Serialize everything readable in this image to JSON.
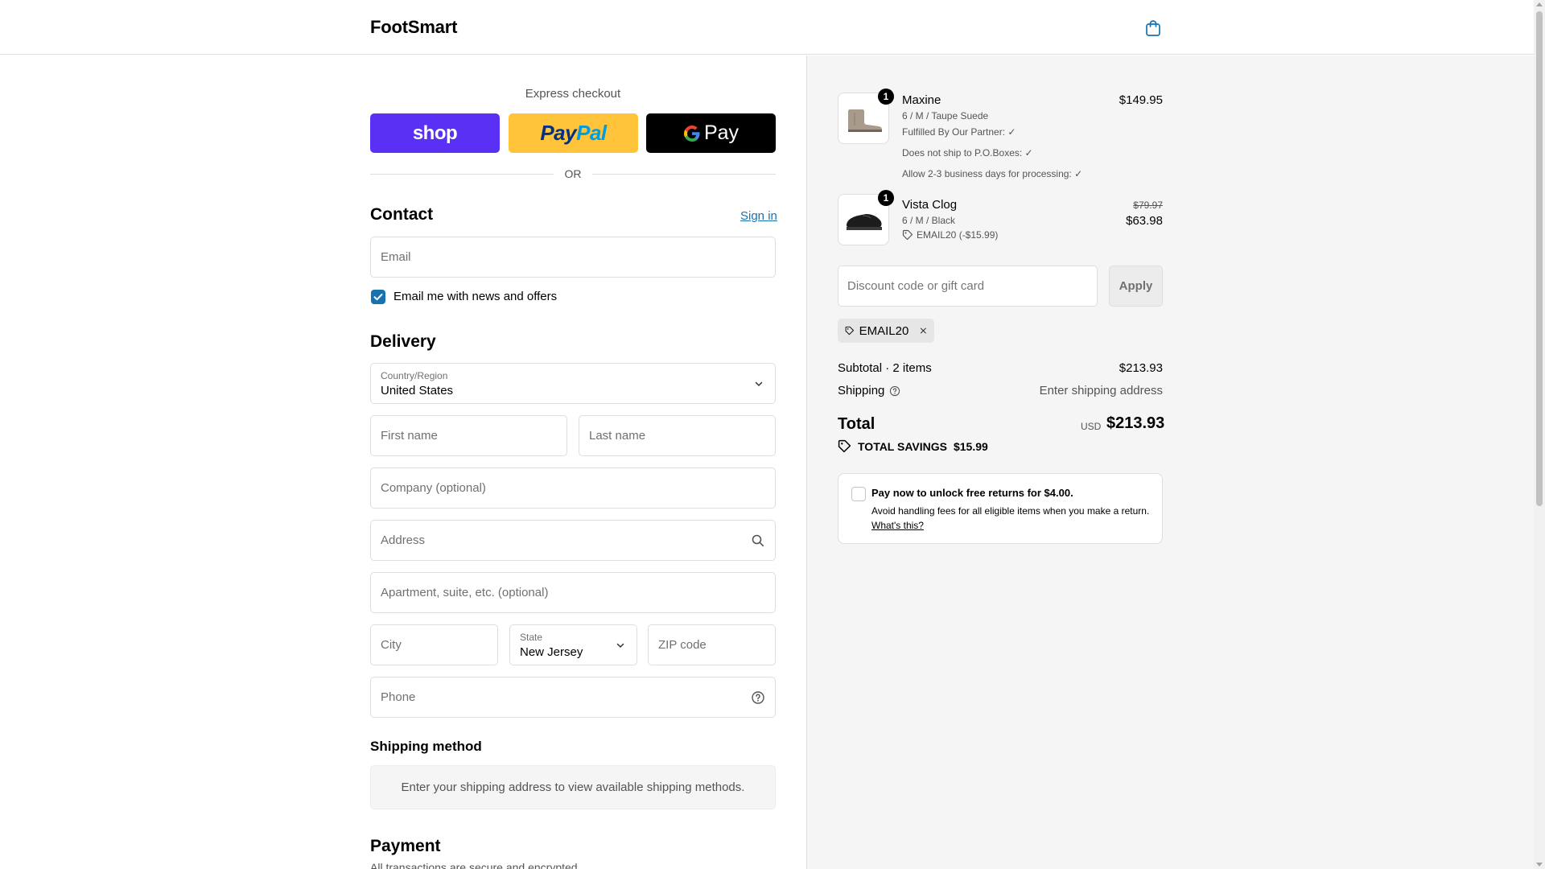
{
  "header": {
    "brand": "FootSmart",
    "cart_icon": "bag-icon"
  },
  "express": {
    "title": "Express checkout",
    "shop_label": "shop",
    "paypal_part1": "Pay",
    "paypal_part2": "Pal",
    "gpay_label": "Pay",
    "or_label": "OR"
  },
  "contact": {
    "heading": "Contact",
    "sign_in": "Sign in",
    "email_placeholder": "Email",
    "newsletter_label": "Email me with news and offers",
    "newsletter_checked": true
  },
  "delivery": {
    "heading": "Delivery",
    "country_label": "Country/Region",
    "country_value": "United States",
    "first_name_placeholder": "First name",
    "last_name_placeholder": "Last name",
    "company_placeholder": "Company (optional)",
    "address_placeholder": "Address",
    "apartment_placeholder": "Apartment, suite, etc. (optional)",
    "city_placeholder": "City",
    "state_label": "State",
    "state_value": "New Jersey",
    "zip_placeholder": "ZIP code",
    "phone_placeholder": "Phone"
  },
  "shipping_method": {
    "heading": "Shipping method",
    "message": "Enter your shipping address to view available shipping methods."
  },
  "payment": {
    "heading": "Payment",
    "subtitle": "All transactions are secure and encrypted."
  },
  "order": {
    "items": [
      {
        "qty": "1",
        "name": "Maxine",
        "variant": "6 / M / Taupe Suede",
        "price": "$149.95",
        "notes": [
          "Fulfilled By Our Partner: ✓",
          "Does not ship to P.O.Boxes: ✓",
          "Allow 2-3 business days for processing: ✓"
        ]
      },
      {
        "qty": "1",
        "name": "Vista Clog",
        "variant": "6 / M / Black",
        "original_price": "$79.97",
        "price": "$63.98",
        "discount": "EMAIL20 (-$15.99)"
      }
    ],
    "discount_placeholder": "Discount code or gift card",
    "apply_label": "Apply",
    "applied_code": "EMAIL20",
    "subtotal_label": "Subtotal · 2 items",
    "subtotal_value": "$213.93",
    "shipping_label": "Shipping",
    "shipping_value": "Enter shipping address",
    "total_label": "Total",
    "currency": "USD",
    "total_value": "$213.93",
    "savings_label": "TOTAL SAVINGS",
    "savings_value": "$15.99"
  },
  "returns": {
    "title": "Pay now to unlock free returns for $4.00.",
    "description": "Avoid handling fees for all eligible items when you make a return.",
    "link": "What's this?"
  },
  "colors": {
    "shop_purple": "#5a31f4",
    "paypal_yellow": "#ffc439",
    "link_blue": "#1773b0",
    "summary_bg": "#f5f5f5"
  }
}
